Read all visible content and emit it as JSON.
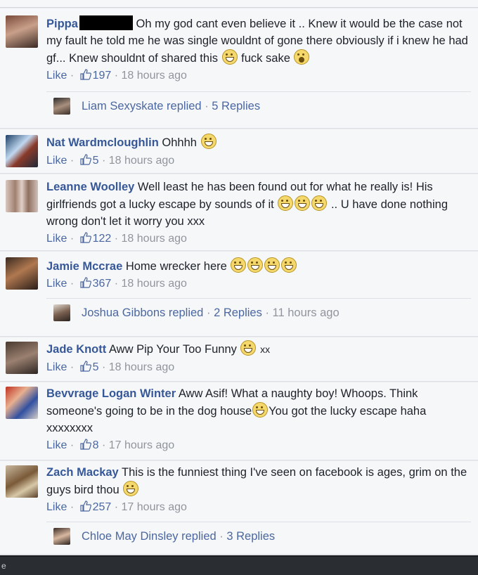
{
  "ui": {
    "like_label": "Like",
    "sep": "·"
  },
  "comments": [
    {
      "author": "Pippa",
      "text": "Oh my god cant even believe it .. Knew it would be the case not my fault he told me he was single wouldnt of gone there obviously if i knew he had gf... Knew shouldnt of shared this",
      "text_tail": "fuck sake",
      "likes": "197",
      "time": "18 hours ago",
      "reply": {
        "name": "Liam Sexyskate replied",
        "count": "5 Replies"
      }
    },
    {
      "author": "Nat Wardmcloughlin",
      "text": "Ohhhh",
      "likes": "5",
      "time": "18 hours ago"
    },
    {
      "author": "Leanne Woolley",
      "text": "Well least he has been found out for what he really is! His girlfriends got a lucky escape by sounds of it",
      "text_tail": ".. U have done nothing wrong don't let it worry you xxx",
      "likes": "122",
      "time": "18 hours ago"
    },
    {
      "author": "Jamie Mccrae",
      "text": "Home wrecker here",
      "likes": "367",
      "time": "18 hours ago",
      "reply": {
        "name": "Joshua Gibbons replied",
        "count": "2 Replies",
        "time": "11 hours ago"
      }
    },
    {
      "author": "Jade Knott",
      "text": "Aww Pip Your Too Funny",
      "text_tail": "xx",
      "likes": "5",
      "time": "18 hours ago"
    },
    {
      "author": "Bevvrage Logan Winter",
      "text": "Aww Asif! What a naughty boy! Whoops. Think someone's going to be in the dog house",
      "text_tail": "You got the lucky escape haha xxxxxxxx",
      "likes": "8",
      "time": "17 hours ago"
    },
    {
      "author": "Zach Mackay",
      "text": "This is the funniest thing I've seen on facebook is ages, grim on the guys bird thou",
      "likes": "257",
      "time": "17 hours ago",
      "reply": {
        "name": "Chloe May Dinsley replied",
        "count": "3 Replies"
      }
    }
  ],
  "colors": {
    "link": "#365899",
    "meta": "#90949c",
    "background": "#f6f7f9"
  },
  "icons": [
    "thumbs-up-icon",
    "laughing-emoji-icon",
    "grinning-emoji-icon",
    "shocked-emoji-icon"
  ],
  "taskbar": {
    "label": "e"
  }
}
